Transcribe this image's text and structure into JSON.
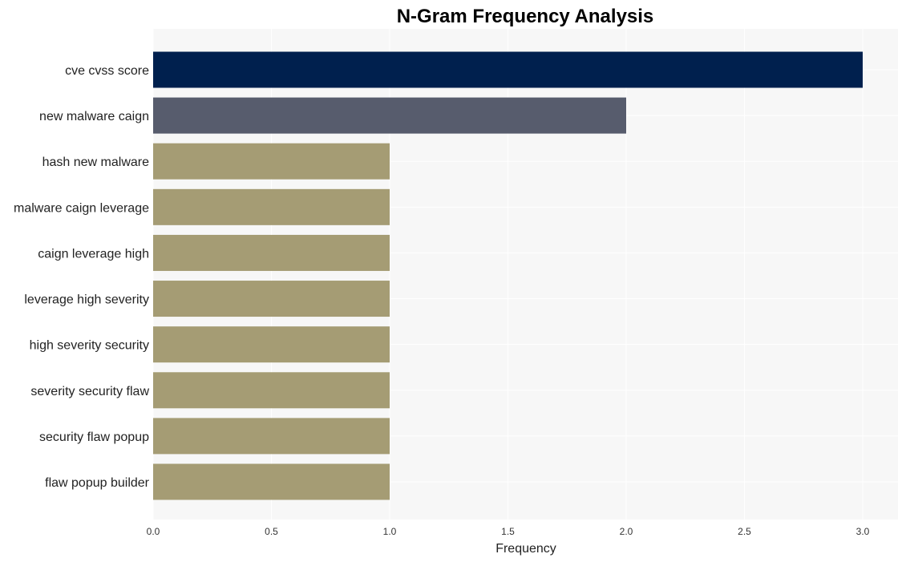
{
  "chart_data": {
    "type": "bar",
    "orientation": "horizontal",
    "title": "N-Gram Frequency Analysis",
    "xlabel": "Frequency",
    "ylabel": "",
    "xlim": [
      0,
      3.15
    ],
    "xticks": [
      0.0,
      0.5,
      1.0,
      1.5,
      2.0,
      2.5,
      3.0
    ],
    "xtick_labels": [
      "0.0",
      "0.5",
      "1.0",
      "1.5",
      "2.0",
      "2.5",
      "3.0"
    ],
    "grid": true,
    "categories": [
      "cve cvss score",
      "new malware caign",
      "hash new malware",
      "malware caign leverage",
      "caign leverage high",
      "leverage high severity",
      "high severity security",
      "severity security flaw",
      "security flaw popup",
      "flaw popup builder"
    ],
    "values": [
      3,
      2,
      1,
      1,
      1,
      1,
      1,
      1,
      1,
      1
    ],
    "colors": [
      "#00204e",
      "#575c6d",
      "#a59c74",
      "#a59c74",
      "#a59c74",
      "#a59c74",
      "#a59c74",
      "#a59c74",
      "#a59c74",
      "#a59c74"
    ]
  },
  "style": {
    "plot_background": "#f7f7f7",
    "grid_color": "#ffffff"
  }
}
